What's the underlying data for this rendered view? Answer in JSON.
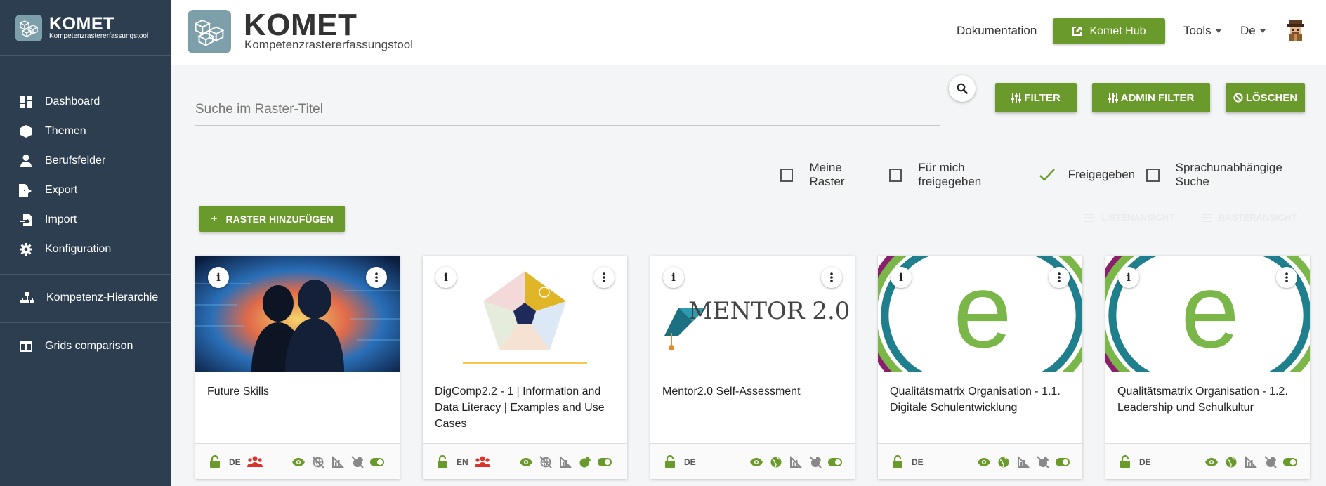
{
  "app": {
    "title": "KOMET",
    "subtitle": "Kompetenzrastererfassungstool"
  },
  "sidebar": {
    "items": [
      {
        "label": "Dashboard",
        "icon": "dashboard-icon"
      },
      {
        "label": "Themen",
        "icon": "cube-icon"
      },
      {
        "label": "Berufsfelder",
        "icon": "user-tie-icon"
      },
      {
        "label": "Export",
        "icon": "file-export-icon"
      },
      {
        "label": "Import",
        "icon": "file-import-icon"
      },
      {
        "label": "Konfiguration",
        "icon": "gear-icon"
      }
    ],
    "hierarchy": {
      "label": "Kompetenz-Hierarchie",
      "icon": "sitemap-icon"
    },
    "comparison": {
      "label": "Grids comparison",
      "icon": "columns-icon"
    }
  },
  "topbar": {
    "documentation": "Dokumentation",
    "hub": "Komet Hub",
    "tools": "Tools",
    "language": "De"
  },
  "search": {
    "placeholder": "Suche im Raster-Titel",
    "filter": "FILTER",
    "admin_filter": "ADMIN FILTER",
    "clear": "LÖSCHEN"
  },
  "checkboxes": [
    {
      "label": "Meine Raster",
      "checked": false
    },
    {
      "label": "Für mich freigegeben",
      "checked": false
    },
    {
      "label": "Freigegeben",
      "checked": true
    },
    {
      "label": "Sprachunabhängige Suche",
      "checked": false
    }
  ],
  "add_button": "RASTER HINZUFÜGEN",
  "views": {
    "list": "LISTENANSICHT",
    "grid": "RASTERANSICHT"
  },
  "cards": [
    {
      "title": "Future Skills",
      "lang": "DE",
      "image": "future-skills-image"
    },
    {
      "title": "DigComp2.2 - 1 | Information and Data Literacy | Examples and Use Cases",
      "lang": "EN",
      "image": "digcomp-pentagon-image"
    },
    {
      "title": "Mentor2.0 Self-Assessment",
      "lang": "DE",
      "image": "mentor-logo-image",
      "image_text": "MENTOR 2.0"
    },
    {
      "title": "Qualitätsmatrix Organisation - 1.1. Digitale Schulentwicklung",
      "lang": "DE",
      "image": "e-logo-image",
      "image_text": "e"
    },
    {
      "title": "Qualitätsmatrix Organisation - 1.2. Leadership und Schulkultur",
      "lang": "DE",
      "image": "e-logo-image",
      "image_text": "e"
    }
  ],
  "colors": {
    "sidebar": "#2c3e50",
    "accent": "#6b9a2c",
    "red": "#d9342b"
  }
}
